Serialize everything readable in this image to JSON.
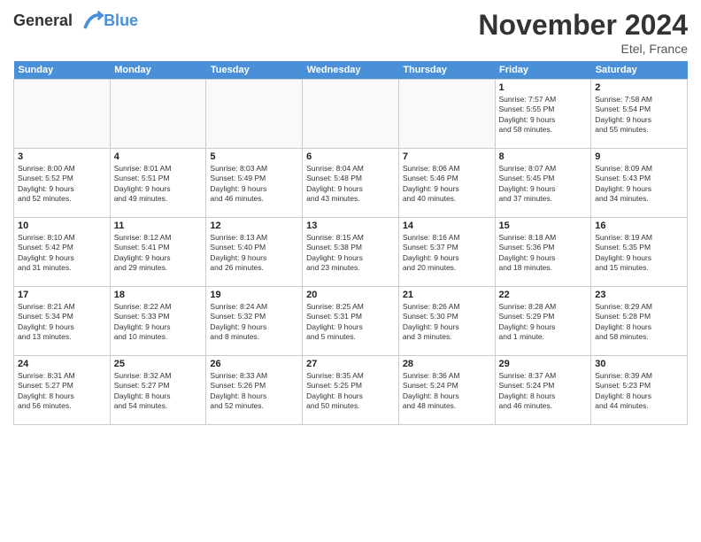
{
  "header": {
    "logo_line1": "General",
    "logo_line2": "Blue",
    "month": "November 2024",
    "location": "Etel, France"
  },
  "days_of_week": [
    "Sunday",
    "Monday",
    "Tuesday",
    "Wednesday",
    "Thursday",
    "Friday",
    "Saturday"
  ],
  "weeks": [
    [
      {
        "day": "",
        "info": ""
      },
      {
        "day": "",
        "info": ""
      },
      {
        "day": "",
        "info": ""
      },
      {
        "day": "",
        "info": ""
      },
      {
        "day": "",
        "info": ""
      },
      {
        "day": "1",
        "info": "Sunrise: 7:57 AM\nSunset: 5:55 PM\nDaylight: 9 hours\nand 58 minutes."
      },
      {
        "day": "2",
        "info": "Sunrise: 7:58 AM\nSunset: 5:54 PM\nDaylight: 9 hours\nand 55 minutes."
      }
    ],
    [
      {
        "day": "3",
        "info": "Sunrise: 8:00 AM\nSunset: 5:52 PM\nDaylight: 9 hours\nand 52 minutes."
      },
      {
        "day": "4",
        "info": "Sunrise: 8:01 AM\nSunset: 5:51 PM\nDaylight: 9 hours\nand 49 minutes."
      },
      {
        "day": "5",
        "info": "Sunrise: 8:03 AM\nSunset: 5:49 PM\nDaylight: 9 hours\nand 46 minutes."
      },
      {
        "day": "6",
        "info": "Sunrise: 8:04 AM\nSunset: 5:48 PM\nDaylight: 9 hours\nand 43 minutes."
      },
      {
        "day": "7",
        "info": "Sunrise: 8:06 AM\nSunset: 5:46 PM\nDaylight: 9 hours\nand 40 minutes."
      },
      {
        "day": "8",
        "info": "Sunrise: 8:07 AM\nSunset: 5:45 PM\nDaylight: 9 hours\nand 37 minutes."
      },
      {
        "day": "9",
        "info": "Sunrise: 8:09 AM\nSunset: 5:43 PM\nDaylight: 9 hours\nand 34 minutes."
      }
    ],
    [
      {
        "day": "10",
        "info": "Sunrise: 8:10 AM\nSunset: 5:42 PM\nDaylight: 9 hours\nand 31 minutes."
      },
      {
        "day": "11",
        "info": "Sunrise: 8:12 AM\nSunset: 5:41 PM\nDaylight: 9 hours\nand 29 minutes."
      },
      {
        "day": "12",
        "info": "Sunrise: 8:13 AM\nSunset: 5:40 PM\nDaylight: 9 hours\nand 26 minutes."
      },
      {
        "day": "13",
        "info": "Sunrise: 8:15 AM\nSunset: 5:38 PM\nDaylight: 9 hours\nand 23 minutes."
      },
      {
        "day": "14",
        "info": "Sunrise: 8:16 AM\nSunset: 5:37 PM\nDaylight: 9 hours\nand 20 minutes."
      },
      {
        "day": "15",
        "info": "Sunrise: 8:18 AM\nSunset: 5:36 PM\nDaylight: 9 hours\nand 18 minutes."
      },
      {
        "day": "16",
        "info": "Sunrise: 8:19 AM\nSunset: 5:35 PM\nDaylight: 9 hours\nand 15 minutes."
      }
    ],
    [
      {
        "day": "17",
        "info": "Sunrise: 8:21 AM\nSunset: 5:34 PM\nDaylight: 9 hours\nand 13 minutes."
      },
      {
        "day": "18",
        "info": "Sunrise: 8:22 AM\nSunset: 5:33 PM\nDaylight: 9 hours\nand 10 minutes."
      },
      {
        "day": "19",
        "info": "Sunrise: 8:24 AM\nSunset: 5:32 PM\nDaylight: 9 hours\nand 8 minutes."
      },
      {
        "day": "20",
        "info": "Sunrise: 8:25 AM\nSunset: 5:31 PM\nDaylight: 9 hours\nand 5 minutes."
      },
      {
        "day": "21",
        "info": "Sunrise: 8:26 AM\nSunset: 5:30 PM\nDaylight: 9 hours\nand 3 minutes."
      },
      {
        "day": "22",
        "info": "Sunrise: 8:28 AM\nSunset: 5:29 PM\nDaylight: 9 hours\nand 1 minute."
      },
      {
        "day": "23",
        "info": "Sunrise: 8:29 AM\nSunset: 5:28 PM\nDaylight: 8 hours\nand 58 minutes."
      }
    ],
    [
      {
        "day": "24",
        "info": "Sunrise: 8:31 AM\nSunset: 5:27 PM\nDaylight: 8 hours\nand 56 minutes."
      },
      {
        "day": "25",
        "info": "Sunrise: 8:32 AM\nSunset: 5:27 PM\nDaylight: 8 hours\nand 54 minutes."
      },
      {
        "day": "26",
        "info": "Sunrise: 8:33 AM\nSunset: 5:26 PM\nDaylight: 8 hours\nand 52 minutes."
      },
      {
        "day": "27",
        "info": "Sunrise: 8:35 AM\nSunset: 5:25 PM\nDaylight: 8 hours\nand 50 minutes."
      },
      {
        "day": "28",
        "info": "Sunrise: 8:36 AM\nSunset: 5:24 PM\nDaylight: 8 hours\nand 48 minutes."
      },
      {
        "day": "29",
        "info": "Sunrise: 8:37 AM\nSunset: 5:24 PM\nDaylight: 8 hours\nand 46 minutes."
      },
      {
        "day": "30",
        "info": "Sunrise: 8:39 AM\nSunset: 5:23 PM\nDaylight: 8 hours\nand 44 minutes."
      }
    ]
  ]
}
